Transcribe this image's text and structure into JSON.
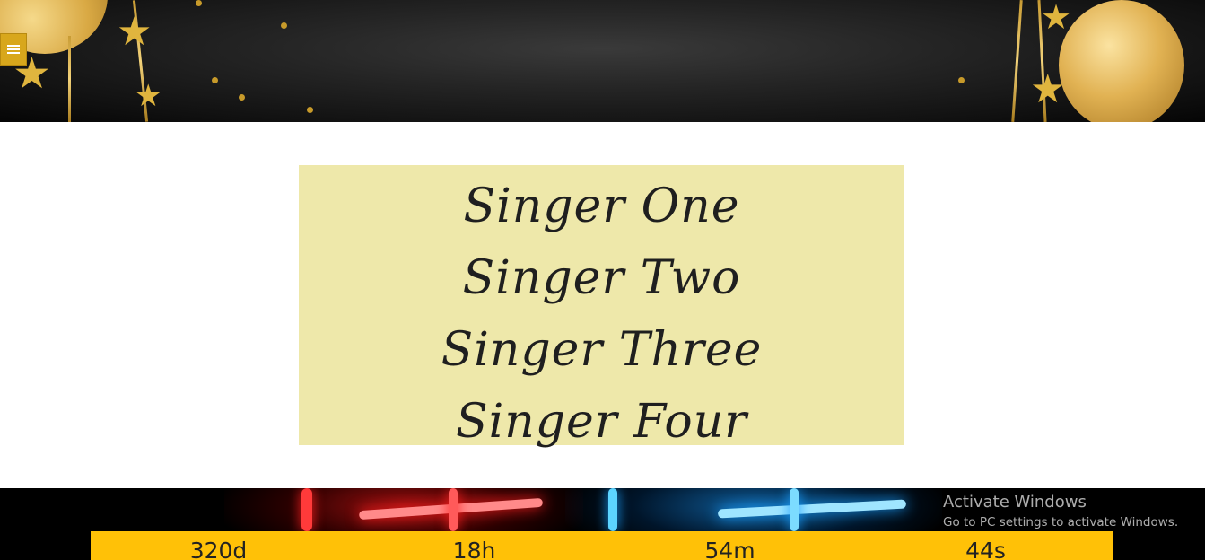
{
  "header": {
    "menu_icon": "hamburger-icon"
  },
  "singers": {
    "items": [
      "Singer One",
      "Singer Two",
      "Singer Three",
      "Singer Four"
    ]
  },
  "countdown": {
    "days": "320d",
    "hours": "18h",
    "minutes": "54m",
    "seconds": "44s"
  },
  "watermark": {
    "title": "Activate Windows",
    "subtitle": "Go to PC settings to activate Windows."
  },
  "colors": {
    "menu_button": "#d8a71c",
    "singers_background": "#eee8aa",
    "countdown_bar": "#ffc107"
  }
}
